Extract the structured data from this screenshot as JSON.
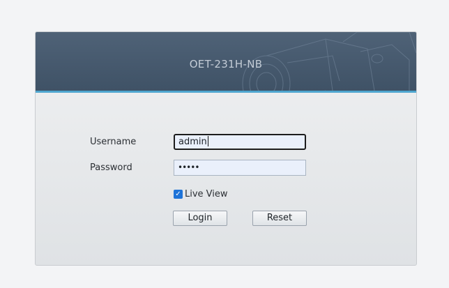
{
  "header": {
    "title": "OET-231H-NB"
  },
  "form": {
    "username_label": "Username",
    "username_value": "admin",
    "password_label": "Password",
    "password_masked": "•••••",
    "live_view_label": "Live View",
    "live_view_checked": true,
    "login_label": "Login",
    "reset_label": "Reset"
  },
  "colors": {
    "header_bg": "#4a5d72",
    "accent_line": "#4fa6cf",
    "checkbox": "#1e73d8"
  }
}
